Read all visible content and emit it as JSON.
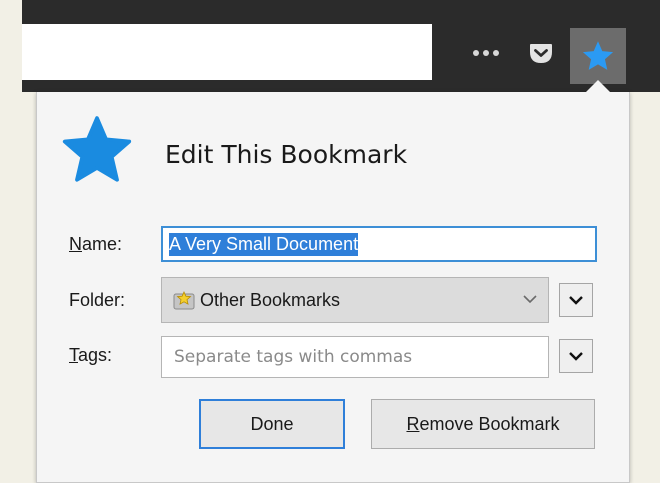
{
  "toolbar": {
    "icons": [
      "more-icon",
      "pocket-icon",
      "star-icon"
    ],
    "accent": "#2b2b2b"
  },
  "panel": {
    "title": "Edit This Bookmark",
    "icon": "star-icon",
    "accent_color": "#1a8be0"
  },
  "fields": {
    "name": {
      "label_key": "N",
      "label_rest": "ame:",
      "value": "A Very Small Document"
    },
    "folder": {
      "label": "Folder:",
      "value": "Other Bookmarks",
      "icon": "folder-star-icon"
    },
    "tags": {
      "label_key": "T",
      "label_rest": "ags:",
      "placeholder": "Separate tags with commas",
      "value": ""
    }
  },
  "buttons": {
    "done": "Done",
    "remove_key": "R",
    "remove_rest": "emove Bookmark"
  }
}
